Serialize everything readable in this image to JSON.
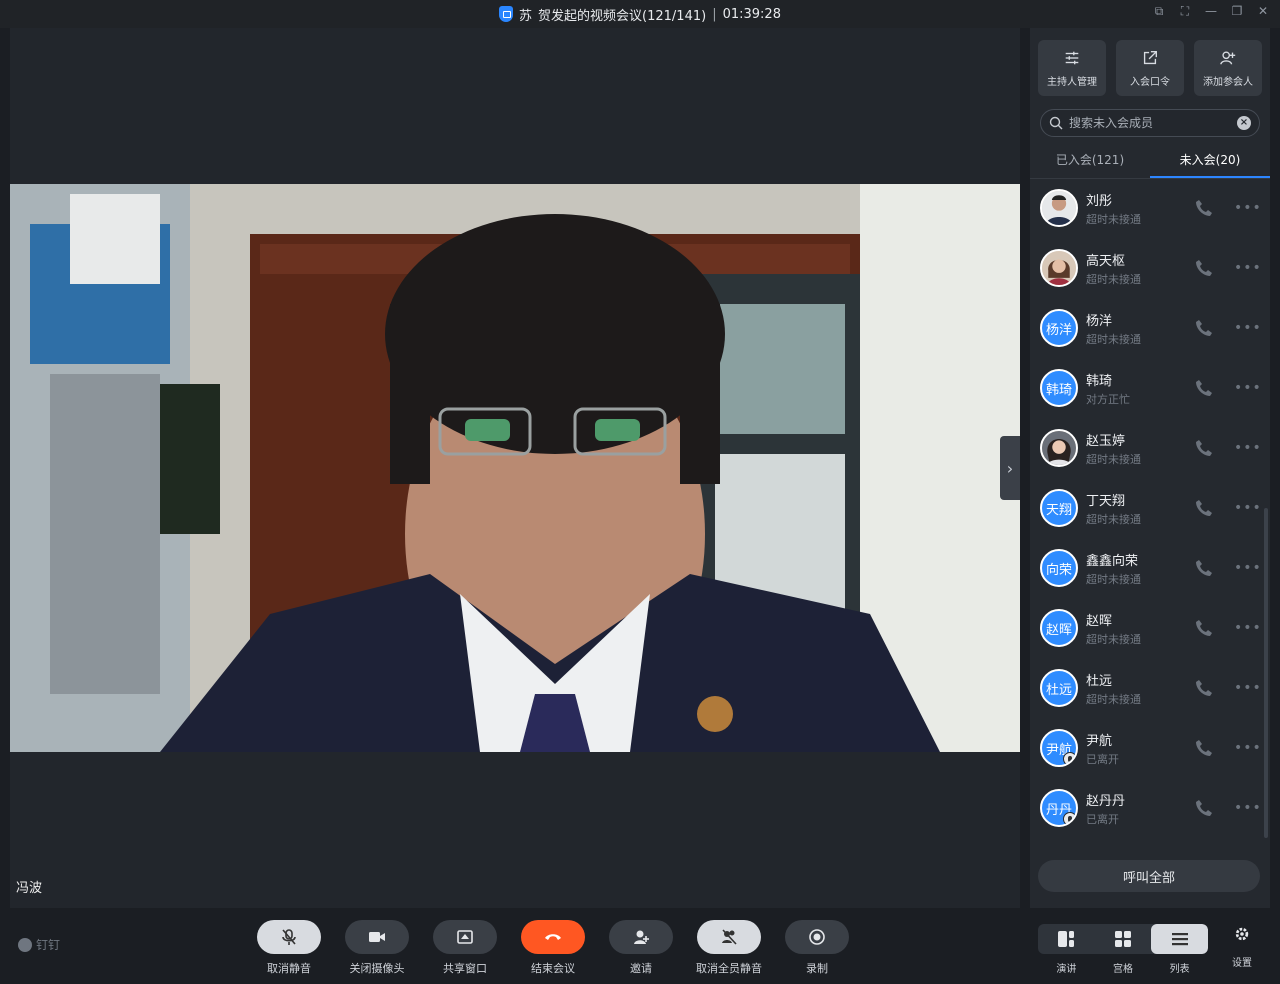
{
  "window": {
    "title_prefix": "苏",
    "title": "贺发起的视频会议(121/141)",
    "separator": "|",
    "timer": "01:39:28"
  },
  "stage": {
    "speaker_name": "冯波"
  },
  "panel": {
    "actions": [
      {
        "label": "主持人管理",
        "icon": "sliders-icon"
      },
      {
        "label": "入会口令",
        "icon": "share-link-icon"
      },
      {
        "label": "添加参会人",
        "icon": "add-person-icon"
      }
    ],
    "search_placeholder": "搜索未入会成员",
    "tabs": [
      {
        "label": "已入会(121)",
        "active": false
      },
      {
        "label": "未入会(20)",
        "active": true
      }
    ],
    "members": [
      {
        "name": "刘彤",
        "status": "超时未接通",
        "avatar": "photo"
      },
      {
        "name": "高天枢",
        "status": "超时未接通",
        "avatar": "photo"
      },
      {
        "name": "杨洋",
        "status": "超时未接通",
        "avatar_text": "杨洋"
      },
      {
        "name": "韩琦",
        "status": "对方正忙",
        "avatar_text": "韩琦"
      },
      {
        "name": "赵玉婷",
        "status": "超时未接通",
        "avatar": "photo"
      },
      {
        "name": "丁天翔",
        "status": "超时未接通",
        "avatar_text": "天翔"
      },
      {
        "name": "鑫鑫向荣",
        "status": "超时未接通",
        "avatar_text": "向荣"
      },
      {
        "name": "赵晖",
        "status": "超时未接通",
        "avatar_text": "赵晖"
      },
      {
        "name": "杜远",
        "status": "超时未接通",
        "avatar_text": "杜远"
      },
      {
        "name": "尹航",
        "status": "已离开",
        "avatar_text": "尹航"
      },
      {
        "name": "赵丹丹",
        "status": "已离开",
        "avatar_text": "丹丹"
      }
    ],
    "call_all": "呼叫全部"
  },
  "toolbar": {
    "brand": "钉钉",
    "buttons": [
      {
        "label": "取消静音",
        "icon": "mic-muted-icon"
      },
      {
        "label": "关闭摄像头",
        "icon": "camera-icon"
      },
      {
        "label": "共享窗口",
        "icon": "share-screen-icon"
      },
      {
        "label": "结束会议",
        "icon": "hangup-icon"
      },
      {
        "label": "邀请",
        "icon": "invite-icon"
      },
      {
        "label": "取消全员静音",
        "icon": "mute-all-icon"
      },
      {
        "label": "录制",
        "icon": "record-icon"
      }
    ],
    "layouts": [
      {
        "label": "演讲",
        "active": false
      },
      {
        "label": "宫格",
        "active": false
      },
      {
        "label": "列表",
        "active": true
      }
    ],
    "settings_label": "设置"
  },
  "colors": {
    "accent": "#2d86ff",
    "avatar_blue": "#2f8cff",
    "end_call": "#ff5722",
    "background": "#1b1e23"
  }
}
